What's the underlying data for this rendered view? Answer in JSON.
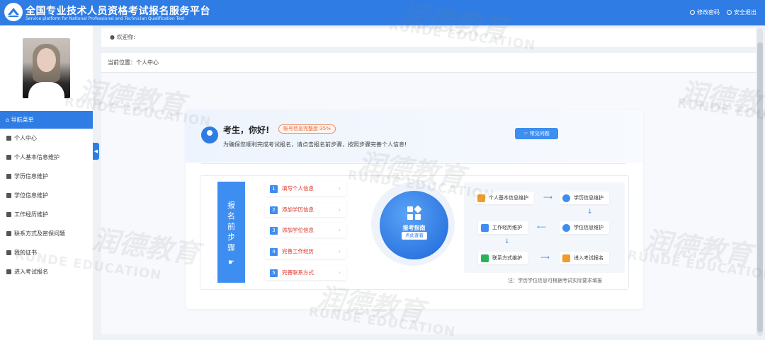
{
  "header": {
    "title": "全国专业技术人员资格考试报名服务平台",
    "subtitle": "Service platform for National Professional and Technician Qualification Test",
    "links": [
      {
        "label": "修改密码",
        "icon": "settings-icon"
      },
      {
        "label": "安全退出",
        "icon": "power-icon"
      }
    ]
  },
  "sidebar": {
    "nav_header": "导航菜单",
    "items": [
      {
        "label": "个人中心",
        "icon": "home-icon"
      },
      {
        "label": "个人基本信息维护",
        "icon": "user-icon"
      },
      {
        "label": "学历信息维护",
        "icon": "graduation-cap-icon"
      },
      {
        "label": "学位信息维护",
        "icon": "medal-icon"
      },
      {
        "label": "工作经历维护",
        "icon": "briefcase-icon"
      },
      {
        "label": "联系方式及密保问题",
        "icon": "phone-icon"
      },
      {
        "label": "我的证书",
        "icon": "certificate-icon"
      },
      {
        "label": "进入考试报名",
        "icon": "arrow-circle-icon"
      }
    ]
  },
  "welcome": {
    "prefix": "欢迎你:"
  },
  "breadcrumb": "当前位置：个人中心",
  "card": {
    "greeting": "考生，你好!",
    "progress_badge": "账号信息完整度:35%",
    "progress_percent": 35,
    "tip": "为确保您顺利完成考试报名，请点击报名前步骤，按照步骤完善个人信息!",
    "faq_button": "常见问题"
  },
  "steps": {
    "label_chars": [
      "报",
      "名",
      "前",
      "步",
      "骤"
    ],
    "items": [
      {
        "num": "1",
        "label": "填写个人信息"
      },
      {
        "num": "2",
        "label": "添加学历信息"
      },
      {
        "num": "3",
        "label": "添加学位信息"
      },
      {
        "num": "4",
        "label": "完善工作经历"
      },
      {
        "num": "5",
        "label": "完善联系方式"
      }
    ]
  },
  "guide": {
    "label": "报考指南",
    "tag": "点此查看"
  },
  "flow": {
    "nodes": [
      {
        "label": "个人基本信息维护",
        "icon": "user-icon",
        "color": "#f39a2b"
      },
      {
        "label": "学历信息维护",
        "icon": "graduation-cap-icon",
        "color": "#3d8ef0"
      },
      {
        "label": "工作经历维护",
        "icon": "briefcase-icon",
        "color": "#3d8ef0"
      },
      {
        "label": "学位信息维护",
        "icon": "medal-icon",
        "color": "#3d8ef0"
      },
      {
        "label": "联系方式维护",
        "icon": "phone-icon",
        "color": "#27b35a"
      },
      {
        "label": "进入考试报名",
        "icon": "arrow-circle-icon",
        "color": "#f39a2b"
      }
    ],
    "note": "注：学历学位信息可根据考试实际要求填报"
  },
  "watermark": {
    "text": "润德教育",
    "sub": "RUNDE EDUCATION"
  },
  "colors": {
    "primary": "#2e7ce4",
    "accent_red": "#d9342b",
    "badge_orange": "#e8663a"
  }
}
